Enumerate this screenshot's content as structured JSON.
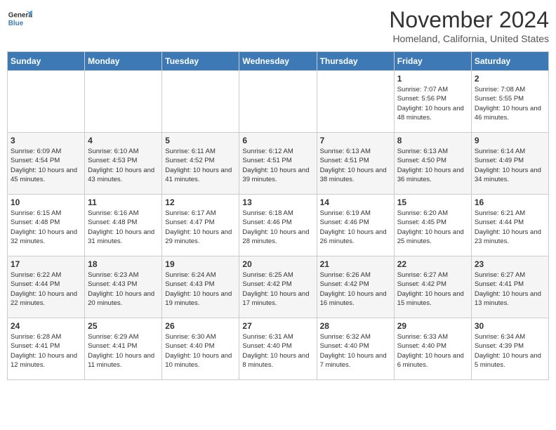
{
  "logo": {
    "line1": "General",
    "line2": "Blue"
  },
  "header": {
    "month": "November 2024",
    "location": "Homeland, California, United States"
  },
  "days_of_week": [
    "Sunday",
    "Monday",
    "Tuesday",
    "Wednesday",
    "Thursday",
    "Friday",
    "Saturday"
  ],
  "weeks": [
    [
      {
        "day": "",
        "info": ""
      },
      {
        "day": "",
        "info": ""
      },
      {
        "day": "",
        "info": ""
      },
      {
        "day": "",
        "info": ""
      },
      {
        "day": "",
        "info": ""
      },
      {
        "day": "1",
        "info": "Sunrise: 7:07 AM\nSunset: 5:56 PM\nDaylight: 10 hours and 48 minutes."
      },
      {
        "day": "2",
        "info": "Sunrise: 7:08 AM\nSunset: 5:55 PM\nDaylight: 10 hours and 46 minutes."
      }
    ],
    [
      {
        "day": "3",
        "info": "Sunrise: 6:09 AM\nSunset: 4:54 PM\nDaylight: 10 hours and 45 minutes."
      },
      {
        "day": "4",
        "info": "Sunrise: 6:10 AM\nSunset: 4:53 PM\nDaylight: 10 hours and 43 minutes."
      },
      {
        "day": "5",
        "info": "Sunrise: 6:11 AM\nSunset: 4:52 PM\nDaylight: 10 hours and 41 minutes."
      },
      {
        "day": "6",
        "info": "Sunrise: 6:12 AM\nSunset: 4:51 PM\nDaylight: 10 hours and 39 minutes."
      },
      {
        "day": "7",
        "info": "Sunrise: 6:13 AM\nSunset: 4:51 PM\nDaylight: 10 hours and 38 minutes."
      },
      {
        "day": "8",
        "info": "Sunrise: 6:13 AM\nSunset: 4:50 PM\nDaylight: 10 hours and 36 minutes."
      },
      {
        "day": "9",
        "info": "Sunrise: 6:14 AM\nSunset: 4:49 PM\nDaylight: 10 hours and 34 minutes."
      }
    ],
    [
      {
        "day": "10",
        "info": "Sunrise: 6:15 AM\nSunset: 4:48 PM\nDaylight: 10 hours and 32 minutes."
      },
      {
        "day": "11",
        "info": "Sunrise: 6:16 AM\nSunset: 4:48 PM\nDaylight: 10 hours and 31 minutes."
      },
      {
        "day": "12",
        "info": "Sunrise: 6:17 AM\nSunset: 4:47 PM\nDaylight: 10 hours and 29 minutes."
      },
      {
        "day": "13",
        "info": "Sunrise: 6:18 AM\nSunset: 4:46 PM\nDaylight: 10 hours and 28 minutes."
      },
      {
        "day": "14",
        "info": "Sunrise: 6:19 AM\nSunset: 4:46 PM\nDaylight: 10 hours and 26 minutes."
      },
      {
        "day": "15",
        "info": "Sunrise: 6:20 AM\nSunset: 4:45 PM\nDaylight: 10 hours and 25 minutes."
      },
      {
        "day": "16",
        "info": "Sunrise: 6:21 AM\nSunset: 4:44 PM\nDaylight: 10 hours and 23 minutes."
      }
    ],
    [
      {
        "day": "17",
        "info": "Sunrise: 6:22 AM\nSunset: 4:44 PM\nDaylight: 10 hours and 22 minutes."
      },
      {
        "day": "18",
        "info": "Sunrise: 6:23 AM\nSunset: 4:43 PM\nDaylight: 10 hours and 20 minutes."
      },
      {
        "day": "19",
        "info": "Sunrise: 6:24 AM\nSunset: 4:43 PM\nDaylight: 10 hours and 19 minutes."
      },
      {
        "day": "20",
        "info": "Sunrise: 6:25 AM\nSunset: 4:42 PM\nDaylight: 10 hours and 17 minutes."
      },
      {
        "day": "21",
        "info": "Sunrise: 6:26 AM\nSunset: 4:42 PM\nDaylight: 10 hours and 16 minutes."
      },
      {
        "day": "22",
        "info": "Sunrise: 6:27 AM\nSunset: 4:42 PM\nDaylight: 10 hours and 15 minutes."
      },
      {
        "day": "23",
        "info": "Sunrise: 6:27 AM\nSunset: 4:41 PM\nDaylight: 10 hours and 13 minutes."
      }
    ],
    [
      {
        "day": "24",
        "info": "Sunrise: 6:28 AM\nSunset: 4:41 PM\nDaylight: 10 hours and 12 minutes."
      },
      {
        "day": "25",
        "info": "Sunrise: 6:29 AM\nSunset: 4:41 PM\nDaylight: 10 hours and 11 minutes."
      },
      {
        "day": "26",
        "info": "Sunrise: 6:30 AM\nSunset: 4:40 PM\nDaylight: 10 hours and 10 minutes."
      },
      {
        "day": "27",
        "info": "Sunrise: 6:31 AM\nSunset: 4:40 PM\nDaylight: 10 hours and 8 minutes."
      },
      {
        "day": "28",
        "info": "Sunrise: 6:32 AM\nSunset: 4:40 PM\nDaylight: 10 hours and 7 minutes."
      },
      {
        "day": "29",
        "info": "Sunrise: 6:33 AM\nSunset: 4:40 PM\nDaylight: 10 hours and 6 minutes."
      },
      {
        "day": "30",
        "info": "Sunrise: 6:34 AM\nSunset: 4:39 PM\nDaylight: 10 hours and 5 minutes."
      }
    ]
  ]
}
